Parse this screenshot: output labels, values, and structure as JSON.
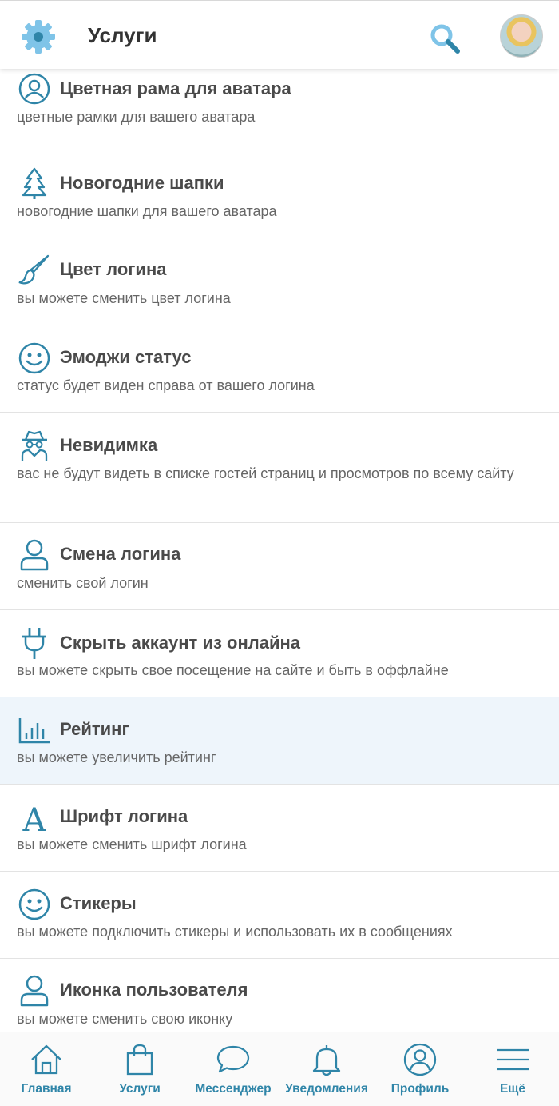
{
  "header": {
    "title": "Услуги"
  },
  "services": [
    {
      "title": "Цветная рама для аватара",
      "desc": "цветные рамки для вашего аватара",
      "icon": "user-circle-icon"
    },
    {
      "title": "Новогодние шапки",
      "desc": "новогодние шапки для вашего аватара",
      "icon": "tree-icon"
    },
    {
      "title": "Цвет логина",
      "desc": "вы можете сменить цвет логина",
      "icon": "brush-icon"
    },
    {
      "title": "Эмоджи статус",
      "desc": "статус будет виден справа от вашего логина",
      "icon": "smile-icon"
    },
    {
      "title": "Невидимка",
      "desc": "вас не будут видеть в списке гостей страниц и просмотров по всему сайту",
      "icon": "spy-icon"
    },
    {
      "title": "Смена логина",
      "desc": "сменить свой логин",
      "icon": "user-icon"
    },
    {
      "title": "Скрыть аккаунт из онлайна",
      "desc": "вы можете скрыть свое посещение на сайте и быть в оффлайне",
      "icon": "plug-icon"
    },
    {
      "title": "Рейтинг",
      "desc": "вы можете увеличить рейтинг",
      "icon": "chart-icon"
    },
    {
      "title": "Шрифт логина",
      "desc": "вы можете сменить шрифт логина",
      "icon": "font-icon"
    },
    {
      "title": "Стикеры",
      "desc": "вы можете подключить стикеры и использовать их в сообщениях",
      "icon": "smile-icon"
    },
    {
      "title": "Иконка пользователя",
      "desc": "вы можете сменить свою иконку",
      "icon": "user-icon"
    }
  ],
  "nav": [
    {
      "label": "Главная",
      "icon": "home-icon"
    },
    {
      "label": "Услуги",
      "icon": "bag-icon"
    },
    {
      "label": "Мессенджер",
      "icon": "chat-icon"
    },
    {
      "label": "Уведомления",
      "icon": "bell-icon"
    },
    {
      "label": "Профиль",
      "icon": "profile-icon"
    },
    {
      "label": "Ещё",
      "icon": "menu-icon"
    }
  ],
  "colors": {
    "accent": "#2f85a8",
    "icon_light": "#7fc4e8",
    "active_row": "#eef5fb"
  }
}
